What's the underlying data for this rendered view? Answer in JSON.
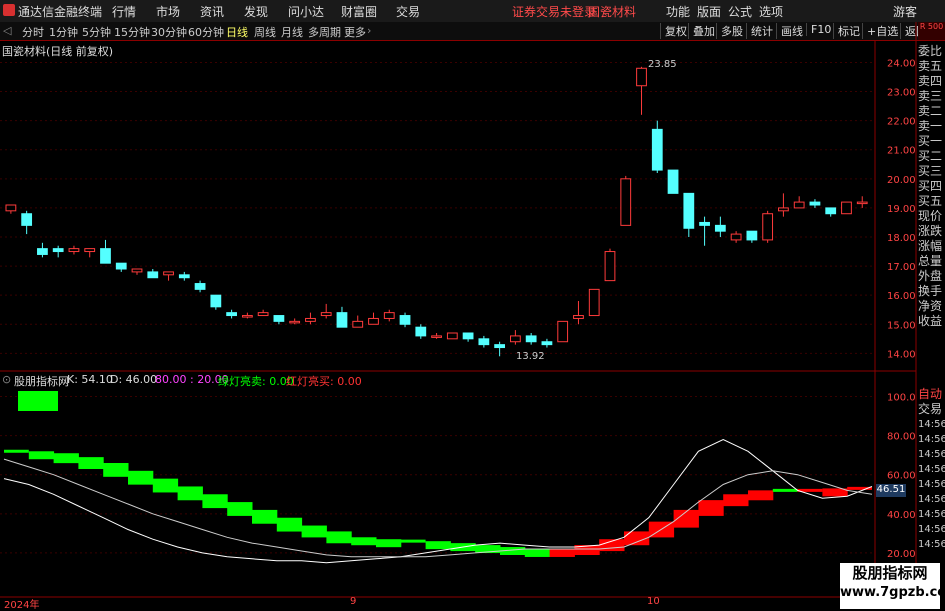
{
  "app": {
    "title": "通达信金融终端"
  },
  "menu": [
    "行情",
    "市场",
    "资讯",
    "发现",
    "问小达",
    "财富圈",
    "交易"
  ],
  "notice": {
    "login": "证券交易未登录",
    "stock": "国瓷材料"
  },
  "right_menu": [
    "功能",
    "版面",
    "公式",
    "选项",
    "游客"
  ],
  "period_tabs": [
    "分时",
    "1分钟",
    "5分钟",
    "15分钟",
    "30分钟",
    "60分钟",
    "日线",
    "周线",
    "月线",
    "多周期",
    "更多"
  ],
  "selected_tab": "日线",
  "toolbar": [
    "复权",
    "叠加",
    "多股",
    "统计",
    "画线",
    "F10",
    "标记",
    "+自选",
    "返回"
  ],
  "price_pane": {
    "title": "国瓷材料(日线 前复权)",
    "high_label": "23.85",
    "low_label": "13.92",
    "yticks": [
      "24.00",
      "23.00",
      "22.00",
      "21.00",
      "20.00",
      "19.00",
      "18.00",
      "17.00",
      "16.00",
      "15.00",
      "14.00"
    ]
  },
  "side_panel": {
    "header": "R 500",
    "items": [
      "委比",
      "卖五",
      "卖四",
      "卖三",
      "卖二",
      "卖一",
      "买一",
      "买二",
      "买三",
      "买四",
      "买五",
      "现价",
      "涨跌",
      "涨幅",
      "总量",
      "外盘",
      "换手",
      "净资",
      "收益"
    ],
    "lower_items": [
      "自动",
      "交易"
    ],
    "times": [
      "14:56",
      "14:56",
      "14:56",
      "14:56",
      "14:56",
      "14:56",
      "14:56",
      "14:56",
      "14:56"
    ]
  },
  "indicator_pane": {
    "name": "股朋指标网",
    "k_label": "K: 54.10",
    "d_label": "D: 46.00",
    "levels": "80.00 : 20.00",
    "green_label": "绿灯亮卖: 0.00",
    "red_label": "红灯亮买: 0.00",
    "current_value": "46.51",
    "yticks": [
      "100.0",
      "80.00",
      "60.00",
      "40.00",
      "20.00"
    ]
  },
  "x_axis": [
    "2024年",
    "9",
    "10"
  ],
  "watermark": {
    "line1": "股朋指标网",
    "line2": "www.7gpzb.com"
  },
  "colors": {
    "up": "#ff3b3b",
    "down": "#54ffff",
    "green": "#00ff00",
    "red": "#ff0000",
    "axis": "#8b0000"
  },
  "chart_data": [
    {
      "type": "candlestick",
      "title": "国瓷材料(日线 前复权)",
      "ylim": [
        13.6,
        24.6
      ],
      "candles": [
        [
          18.9,
          19.1,
          18.8,
          19.1
        ],
        [
          18.8,
          18.4,
          18.1,
          18.9
        ],
        [
          17.6,
          17.4,
          17.3,
          17.8
        ],
        [
          17.6,
          17.5,
          17.3,
          17.7
        ],
        [
          17.5,
          17.6,
          17.4,
          17.7
        ],
        [
          17.5,
          17.6,
          17.3,
          17.6
        ],
        [
          17.6,
          17.1,
          17.1,
          17.9
        ],
        [
          17.1,
          16.9,
          16.8,
          17.1
        ],
        [
          16.8,
          16.9,
          16.7,
          16.9
        ],
        [
          16.8,
          16.6,
          16.6,
          16.9
        ],
        [
          16.7,
          16.8,
          16.5,
          16.8
        ],
        [
          16.7,
          16.6,
          16.5,
          16.8
        ],
        [
          16.4,
          16.2,
          16.1,
          16.5
        ],
        [
          16.0,
          15.6,
          15.5,
          16.0
        ],
        [
          15.4,
          15.3,
          15.2,
          15.5
        ],
        [
          15.3,
          15.3,
          15.2,
          15.4
        ],
        [
          15.3,
          15.4,
          15.3,
          15.5
        ],
        [
          15.3,
          15.1,
          15.0,
          15.3
        ],
        [
          15.1,
          15.1,
          15.0,
          15.2
        ],
        [
          15.1,
          15.2,
          15.0,
          15.4
        ],
        [
          15.3,
          15.4,
          15.2,
          15.7
        ],
        [
          15.4,
          14.9,
          14.9,
          15.6
        ],
        [
          14.9,
          15.1,
          14.9,
          15.3
        ],
        [
          15.0,
          15.2,
          15.0,
          15.4
        ],
        [
          15.2,
          15.4,
          15.1,
          15.5
        ],
        [
          15.3,
          15.0,
          14.9,
          15.4
        ],
        [
          14.9,
          14.6,
          14.5,
          15.0
        ],
        [
          14.6,
          14.6,
          14.5,
          14.7
        ],
        [
          14.5,
          14.7,
          14.5,
          14.7
        ],
        [
          14.7,
          14.5,
          14.4,
          14.7
        ],
        [
          14.5,
          14.3,
          14.2,
          14.6
        ],
        [
          14.3,
          14.2,
          13.9,
          14.4
        ],
        [
          14.4,
          14.6,
          14.3,
          14.8
        ],
        [
          14.6,
          14.4,
          14.3,
          14.7
        ],
        [
          14.4,
          14.3,
          14.2,
          14.5
        ],
        [
          14.4,
          15.1,
          14.4,
          15.1
        ],
        [
          15.2,
          15.3,
          15.0,
          15.8
        ],
        [
          15.3,
          16.2,
          15.3,
          16.2
        ],
        [
          16.5,
          17.5,
          16.5,
          17.6
        ],
        [
          18.4,
          20.0,
          18.4,
          20.1
        ],
        [
          23.2,
          23.8,
          22.2,
          23.85
        ],
        [
          21.7,
          20.3,
          20.2,
          22.0
        ],
        [
          20.3,
          19.5,
          19.5,
          20.3
        ],
        [
          19.5,
          18.3,
          18.0,
          19.5
        ],
        [
          18.5,
          18.4,
          17.7,
          18.7
        ],
        [
          18.4,
          18.2,
          18.0,
          18.7
        ],
        [
          17.9,
          18.1,
          17.8,
          18.2
        ],
        [
          18.2,
          17.9,
          17.8,
          18.2
        ],
        [
          17.9,
          18.8,
          17.8,
          18.9
        ],
        [
          18.9,
          19.0,
          18.7,
          19.5
        ],
        [
          19.0,
          19.2,
          19.0,
          19.4
        ],
        [
          19.2,
          19.1,
          19.0,
          19.3
        ],
        [
          19.0,
          18.8,
          18.7,
          19.0
        ],
        [
          18.8,
          19.2,
          18.8,
          19.2
        ],
        [
          19.2,
          19.2,
          19.0,
          19.4
        ]
      ]
    },
    {
      "type": "line",
      "title": "股朋指标网",
      "ylim": [
        0,
        110
      ],
      "series": [
        {
          "name": "K",
          "values": [
            58,
            55,
            50,
            44,
            38,
            32,
            27,
            23,
            20,
            18,
            17,
            16,
            16,
            15,
            16,
            17,
            18,
            20,
            22,
            24,
            25,
            24,
            23,
            23,
            24,
            28,
            38,
            55,
            72,
            78,
            72,
            62,
            52,
            48,
            49,
            54
          ]
        },
        {
          "name": "D",
          "values": [
            68,
            64,
            60,
            55,
            50,
            45,
            40,
            36,
            32,
            28,
            25,
            23,
            21,
            19,
            18,
            18,
            18,
            18,
            19,
            20,
            21,
            22,
            22,
            22,
            22,
            23,
            28,
            36,
            46,
            55,
            60,
            62,
            60,
            56,
            52,
            50
          ]
        },
        {
          "name": "band",
          "values": [
            72,
            72,
            71,
            69,
            66,
            62,
            58,
            54,
            50,
            46,
            42,
            38,
            34,
            31,
            28,
            27,
            26,
            26,
            25,
            24,
            23,
            22,
            21,
            22,
            24,
            27,
            31,
            36,
            42,
            47,
            50,
            52,
            52,
            52,
            53,
            53
          ]
        }
      ]
    }
  ]
}
